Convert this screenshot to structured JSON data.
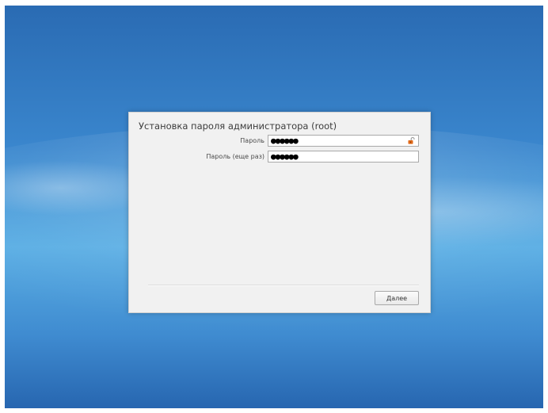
{
  "dialog": {
    "title": "Установка пароля администратора (root)",
    "fields": [
      {
        "label": "Пароль",
        "value": "●●●●●●",
        "icon": "unlocked-padlock-icon"
      },
      {
        "label": "Пароль (еще раз)",
        "value": "●●●●●●"
      }
    ],
    "next_button": "Далее"
  },
  "colors": {
    "desktop_blue": "#3a86cd",
    "lock_orange": "#e06a1a"
  }
}
